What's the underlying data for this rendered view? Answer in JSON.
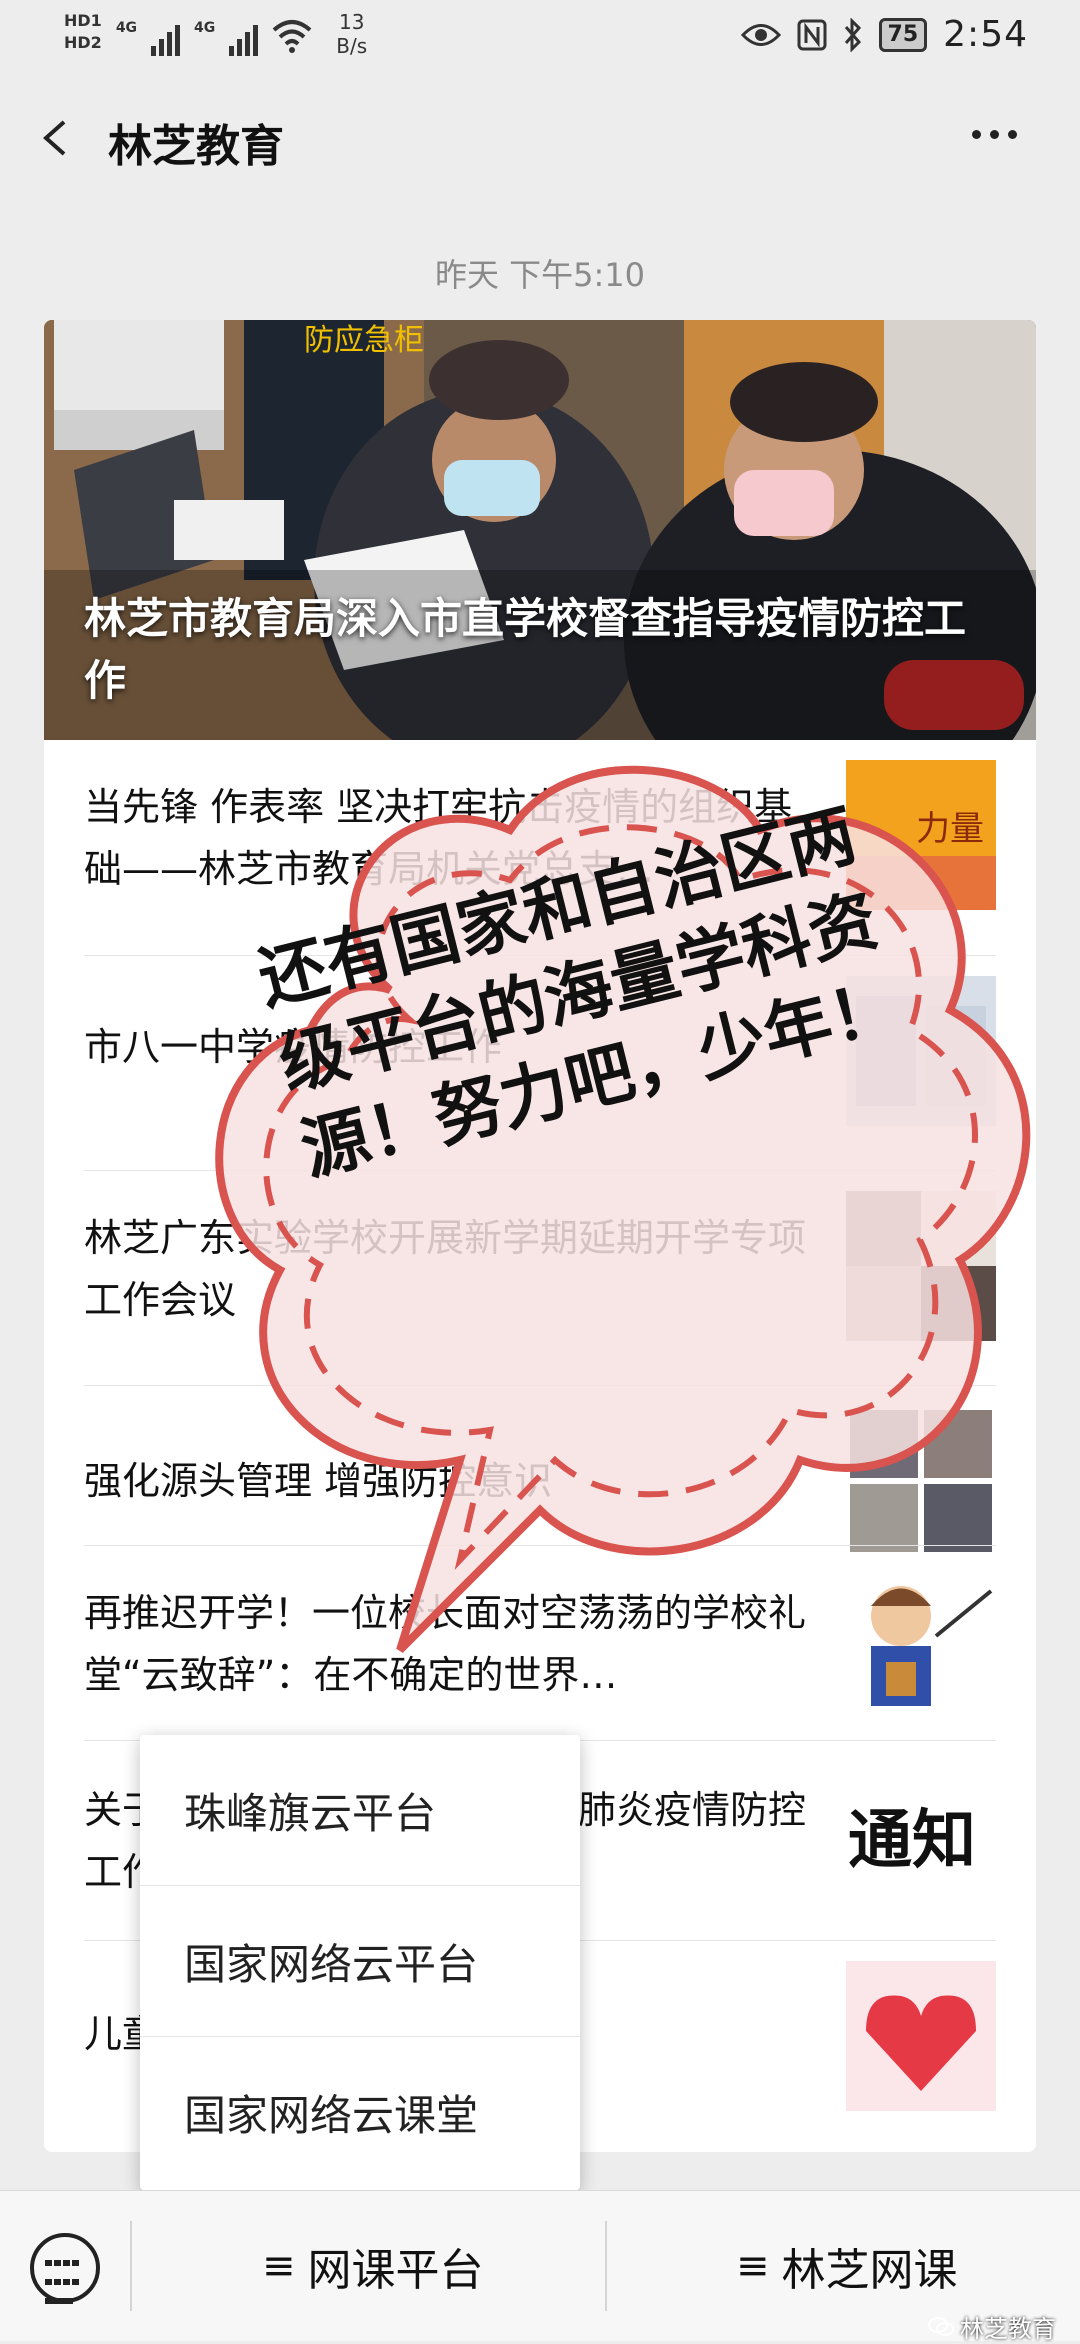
{
  "status_bar": {
    "hd1": "HD1",
    "hd2": "HD2",
    "signal1": "4G",
    "signal2": "4G",
    "net_speed_value": "13",
    "net_speed_unit": "B/s",
    "battery": "75",
    "time": "2:54"
  },
  "header": {
    "title": "林芝教育"
  },
  "timestamp": "昨天 下午5:10",
  "hero": {
    "title": "林芝市教育局深入市直学校督查指导疫情防控工作",
    "cabinet_sign": "防应急柜"
  },
  "articles": [
    {
      "title": "当先锋 作表率 坚决打牢抗击疫情的组织基础——林芝市教育局机关党总支…"
    },
    {
      "title": "市八一中学疫情防控工作"
    },
    {
      "title": "林芝广东实验学校开展新学期延期开学专项工作会议"
    },
    {
      "title": "强化源头管理 增强防控意识"
    },
    {
      "title": "再推迟开学！一位校长面对空荡荡的学校礼堂“云致辞”：在不确定的世界…"
    },
    {
      "title": "关于做好新型冠状病毒感染的肺炎疫情防控工作的通知"
    },
    {
      "title": "儿童"
    }
  ],
  "thumb_labels": {
    "notice": "通知"
  },
  "bubble": {
    "text": "还有国家和自治区两级平台的海量学科资源！努力吧，少年！"
  },
  "popup_menu": {
    "items": [
      "珠峰旗云平台",
      "国家网络云平台",
      "国家网络云课堂"
    ]
  },
  "bottom_menu": {
    "btn1": "网课平台",
    "btn2": "林芝网课",
    "ham": "≡"
  },
  "watermark": "林芝教育",
  "colors": {
    "bubble_fill": "#f7e2e2",
    "bubble_dash": "#d9534f",
    "background": "#ededed"
  }
}
